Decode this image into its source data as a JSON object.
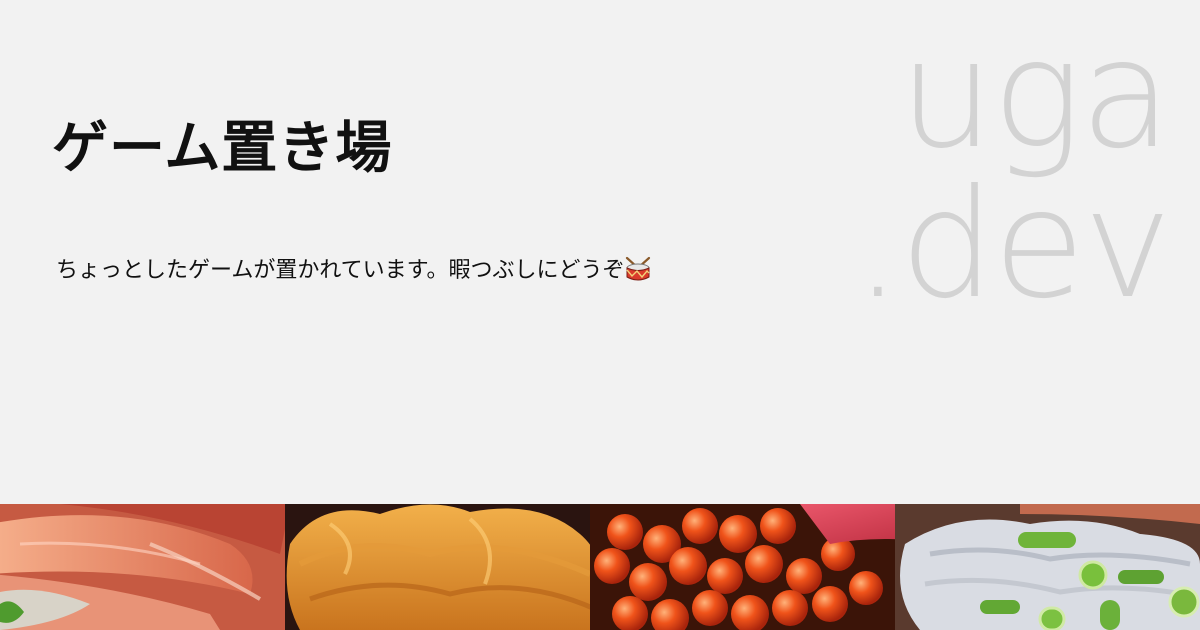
{
  "site": {
    "title": "ゲーム置き場",
    "description": "ちょっとしたゲームが置かれています。暇つぶしにどうぞ",
    "description_icon": "drum-icon"
  },
  "logo": {
    "line1": "uga",
    "line2": ".dev"
  },
  "banner": {
    "image": "sushi-seafood-photo"
  },
  "colors": {
    "background": "#f2f2f2",
    "text": "#111111",
    "logo": "#d3d3d3"
  }
}
